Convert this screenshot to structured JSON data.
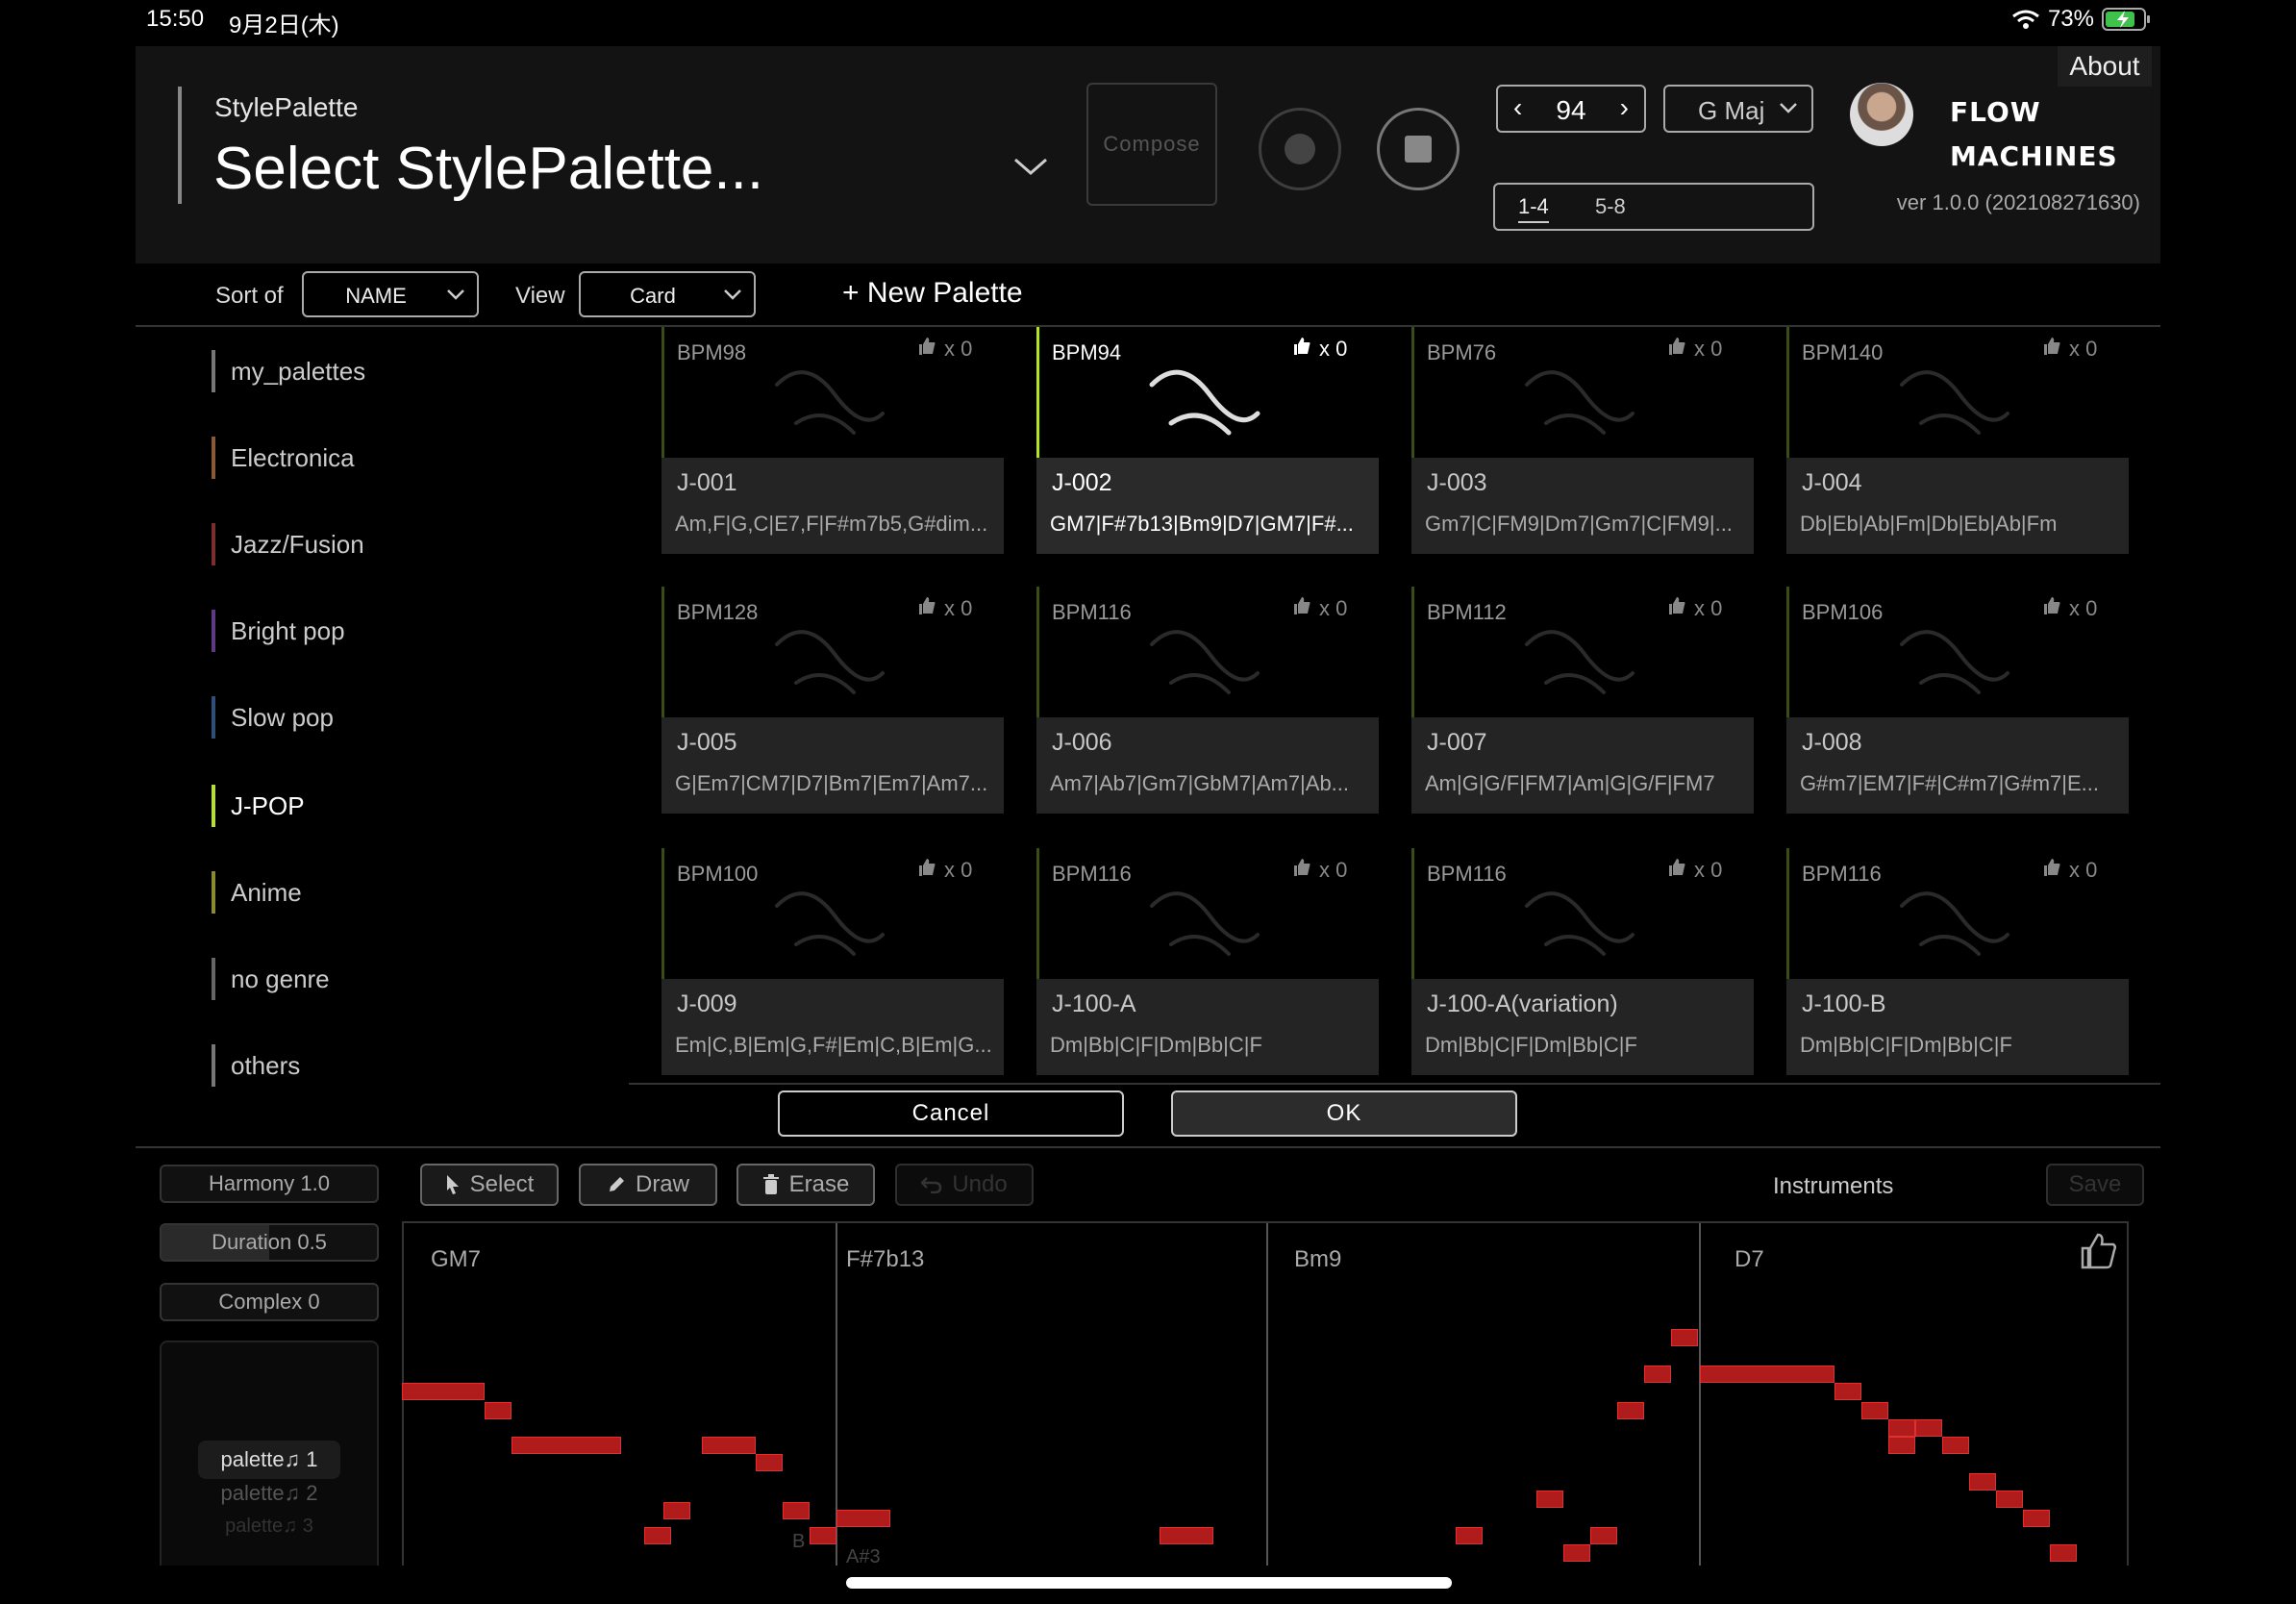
{
  "status_bar": {
    "time": "15:50",
    "date": "9月2日(木)",
    "battery": "73%"
  },
  "header": {
    "about_label": "About",
    "stylepalette_label": "StylePalette",
    "stylepalette_title": "Select StylePalette...",
    "compose_label": "Compose",
    "tempo": "94",
    "key": "G Maj",
    "logo_text": "FLOW MACHINES",
    "bar_tabs": [
      "1-4",
      "5-8"
    ],
    "version": "ver 1.0.0 (202108271630)"
  },
  "toolbar": {
    "sort_label": "Sort of",
    "sort_value": "NAME",
    "view_label": "View",
    "view_value": "Card",
    "new_palette": "+ New Palette"
  },
  "genres": [
    {
      "label": "my_palettes",
      "color": "#777777"
    },
    {
      "label": "Electronica",
      "color": "#8a5a36"
    },
    {
      "label": "Jazz/Fusion",
      "color": "#7a2e2e"
    },
    {
      "label": "Bright pop",
      "color": "#5e3a82"
    },
    {
      "label": "Slow pop",
      "color": "#2e4f78"
    },
    {
      "label": "J-POP",
      "color": "#b6de3a",
      "active": true
    },
    {
      "label": "Anime",
      "color": "#8a8a2e"
    },
    {
      "label": "no genre",
      "color": "#666666"
    },
    {
      "label": "others",
      "color": "#777777"
    }
  ],
  "cards": [
    {
      "bpm": "BPM98",
      "likes": "x 0",
      "name": "J-001",
      "chords": "Am,F|G,C|E7,F|F#m7b5,G#dim..."
    },
    {
      "bpm": "BPM94",
      "likes": "x 0",
      "name": "J-002",
      "chords": "GM7|F#7b13|Bm9|D7|GM7|F#...",
      "selected": true
    },
    {
      "bpm": "BPM76",
      "likes": "x 0",
      "name": "J-003",
      "chords": "Gm7|C|FM9|Dm7|Gm7|C|FM9|..."
    },
    {
      "bpm": "BPM140",
      "likes": "x 0",
      "name": "J-004",
      "chords": "Db|Eb|Ab|Fm|Db|Eb|Ab|Fm"
    },
    {
      "bpm": "BPM128",
      "likes": "x 0",
      "name": "J-005",
      "chords": "G|Em7|CM7|D7|Bm7|Em7|Am7..."
    },
    {
      "bpm": "BPM116",
      "likes": "x 0",
      "name": "J-006",
      "chords": "Am7|Ab7|Gm7|GbM7|Am7|Ab..."
    },
    {
      "bpm": "BPM112",
      "likes": "x 0",
      "name": "J-007",
      "chords": "Am|G|G/F|FM7|Am|G|G/F|FM7"
    },
    {
      "bpm": "BPM106",
      "likes": "x 0",
      "name": "J-008",
      "chords": "G#m7|EM7|F#|C#m7|G#m7|E..."
    },
    {
      "bpm": "BPM100",
      "likes": "x 0",
      "name": "J-009",
      "chords": "Em|C,B|Em|G,F#|Em|C,B|Em|G..."
    },
    {
      "bpm": "BPM116",
      "likes": "x 0",
      "name": "J-100-A",
      "chords": "Dm|Bb|C|F|Dm|Bb|C|F"
    },
    {
      "bpm": "BPM116",
      "likes": "x 0",
      "name": "J-100-A(variation)",
      "chords": "Dm|Bb|C|F|Dm|Bb|C|F"
    },
    {
      "bpm": "BPM116",
      "likes": "x 0",
      "name": "J-100-B",
      "chords": "Dm|Bb|C|F|Dm|Bb|C|F"
    }
  ],
  "dialog": {
    "cancel": "Cancel",
    "ok": "OK"
  },
  "editor": {
    "harmony": "Harmony 1.0",
    "duration": "Duration 0.5",
    "complex": "Complex 0",
    "palettes": [
      "palette♫ 1",
      "palette♫ 2",
      "palette♫ 3"
    ],
    "tools": {
      "select": "Select",
      "draw": "Draw",
      "erase": "Erase",
      "undo": "Undo"
    },
    "instruments": "Instruments",
    "save": "Save",
    "chords": [
      "GM7",
      "F#7b13",
      "Bm9",
      "D7"
    ],
    "note_labels": [
      "B",
      "A#3"
    ]
  },
  "colors": {
    "accent": "#b6de3a",
    "note": "#b01c1c",
    "header_bg": "#131313"
  }
}
